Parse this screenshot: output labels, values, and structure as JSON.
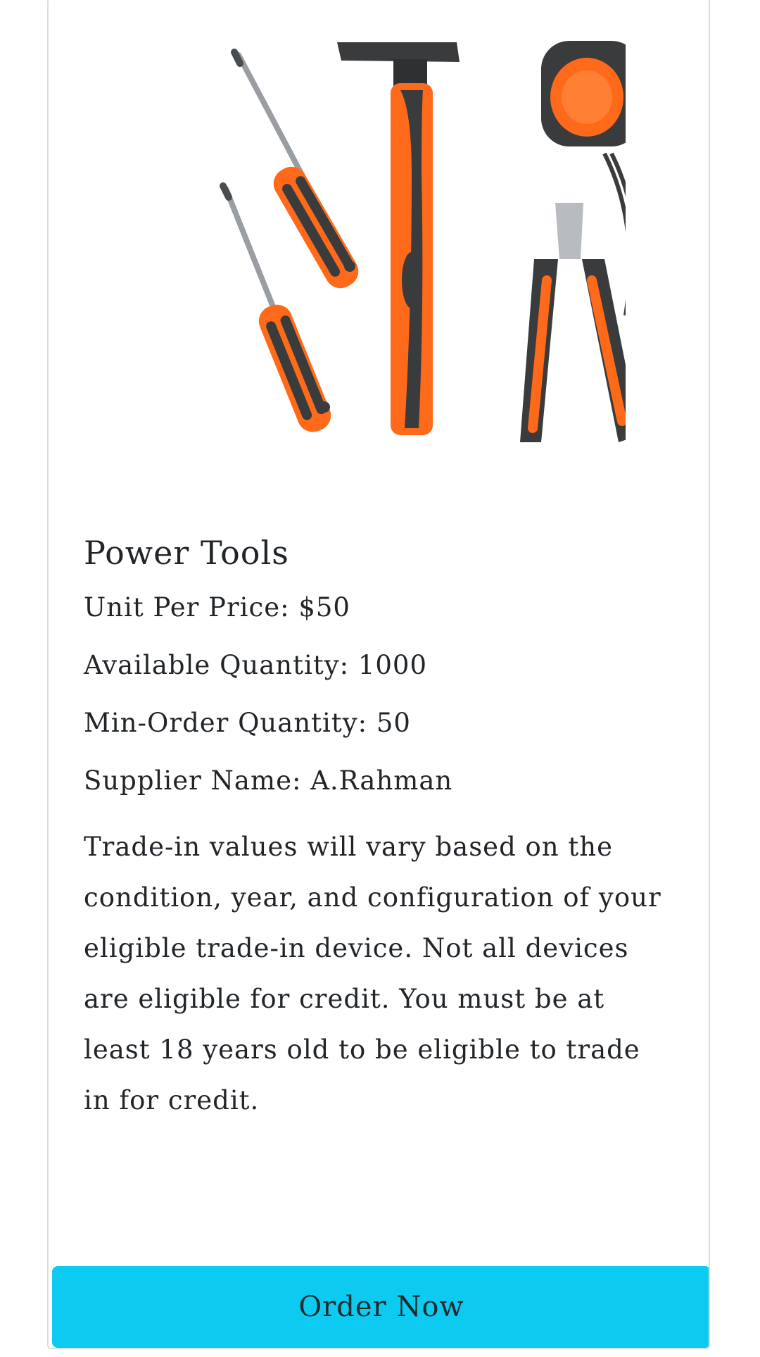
{
  "product": {
    "image_alt": "Power tools set",
    "title": "Power Tools",
    "unit_price": "Unit Per Price: $50",
    "available_quantity": "Available Quantity: 1000",
    "min_order_quantity": "Min-Order Quantity: 50",
    "supplier_name": "Supplier Name: A.Rahman",
    "description": "Trade-in values will vary based on the condition, year, and configuration of your eligible trade-in device. Not all devices are eligible for credit. You must be at least 18 years old to be eligible to trade in for credit."
  },
  "actions": {
    "order_label": "Order Now"
  },
  "colors": {
    "accent": "#0dcaf0",
    "tool_orange": "#ff6a1a",
    "tool_dark": "#3a3b3d"
  }
}
